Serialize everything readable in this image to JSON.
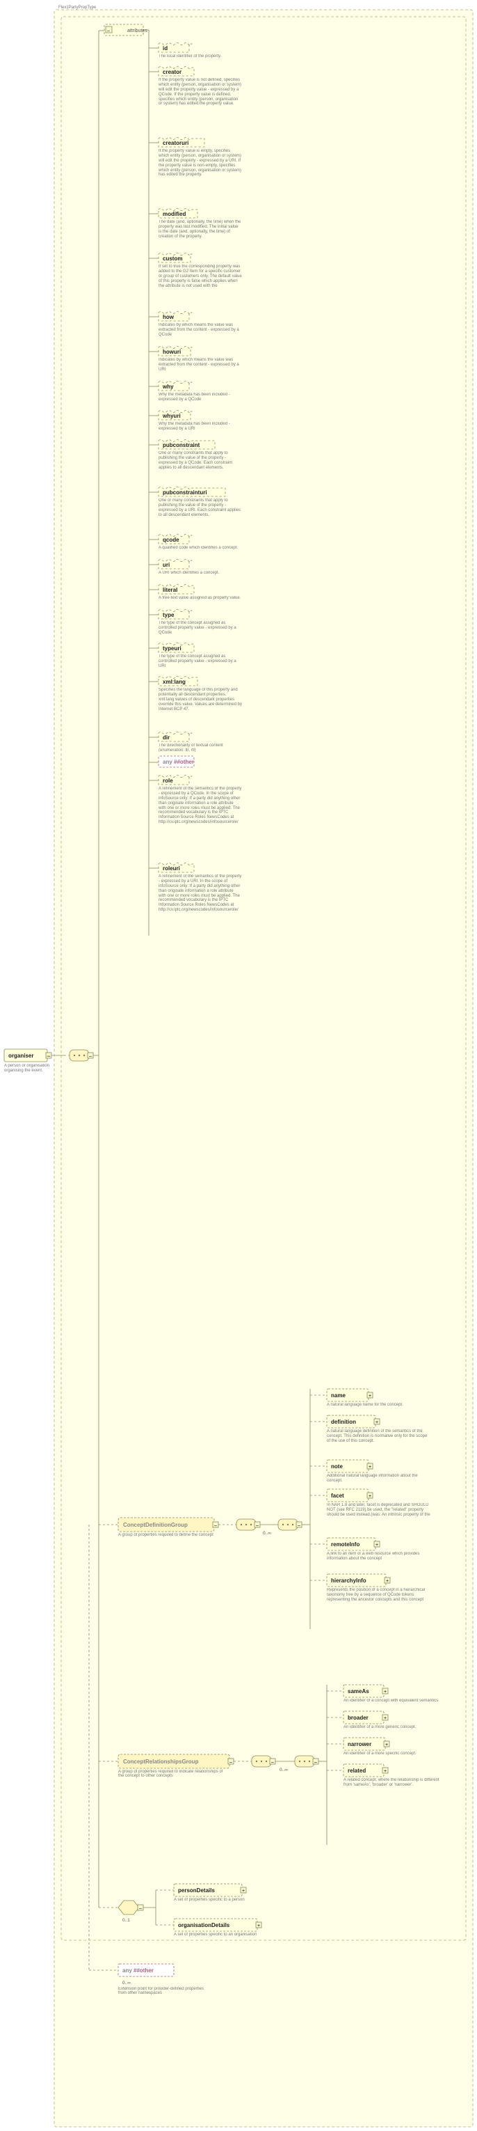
{
  "header": {
    "title": "Flex1PartyPropType"
  },
  "root": {
    "name": "organiser",
    "desc": "A person or organisation organising the event."
  },
  "attributes_label": "attributes",
  "attrs": [
    {
      "key": "id",
      "name": "id",
      "desc": "The local identifier of the property."
    },
    {
      "key": "creator",
      "name": "creator",
      "desc": "If the property value is not defined, specifies which entity (person, organisation or system) will edit the property value - expressed by a QCode. If the property value is defined, specifies which entity (person, organisation or system) has edited the property  value."
    },
    {
      "key": "creatoruri",
      "name": "creatoruri",
      "desc": "If the property value is empty, specifies which entity (person, organisation or system) will edit the property - expressed by a URI. If the property value is non-empty, specifies which entity (person, organisation or system) has edited the property."
    },
    {
      "key": "modified",
      "name": "modified",
      "desc": "The date (and, optionally, the time) when the property was last modified. The initial value is the date (and, optionally, the time) of creation of the property."
    },
    {
      "key": "custom",
      "name": "custom",
      "desc": "If set to true the corresponding property was added to the G2 Item for a specific customer or group of customers only. The default value of this property is false which applies when the attribute is not used with the"
    },
    {
      "key": "how",
      "name": "how",
      "desc": "Indicates by which means the value was extracted from the content -  expressed by a QCode"
    },
    {
      "key": "howuri",
      "name": "howuri",
      "desc": "Indicates by which means the value was extracted from the content - expressed by a URI"
    },
    {
      "key": "why",
      "name": "why",
      "desc": "Why the metadata has been included - expressed by a QCode"
    },
    {
      "key": "whyuri",
      "name": "whyuri",
      "desc": "Why the metadata has been included - expressed by a URI"
    },
    {
      "key": "pubconstraint",
      "name": "pubconstraint",
      "desc": "One or many constraints that apply to publishing the value of the property - expressed by a QCode. Each constraint applies to all descendant elements."
    },
    {
      "key": "pubconstrainturi",
      "name": "pubconstrainturi",
      "desc": "One or many constraints that apply to publishing the value of the property - expressed by a URI. Each constraint applies to all descendant elements."
    },
    {
      "key": "qcode",
      "name": "qcode",
      "desc": "A qualified code which identifies a concept."
    },
    {
      "key": "uri",
      "name": "uri",
      "desc": "A URI which identifies a concept."
    },
    {
      "key": "literal",
      "name": "literal",
      "desc": "A free-text value assigned as property value."
    },
    {
      "key": "type",
      "name": "type",
      "desc": "The type of the concept assigned as controlled property value - expressed by a QCode"
    },
    {
      "key": "typeuri",
      "name": "typeuri",
      "desc": "The type of the concept assigned as controlled property value - expressed by a URI"
    },
    {
      "key": "xmllang",
      "name": "xml:lang",
      "desc": "Specifies the language of this property and potentially all descendant properties. xml:lang values of descendant properties override this value. Values are determined by Internet BCP 47."
    },
    {
      "key": "dir",
      "name": "dir",
      "desc": "The directionality of textual content (enumeration: ltr, rtl)"
    },
    {
      "key": "anyother",
      "name": "##other",
      "desc": "",
      "any": true
    },
    {
      "key": "role",
      "name": "role",
      "desc": "A refinement of the semantics of the property - expressed by a QCode. In the scope of infoSource only: If a party did anything other than originate information a role attribute with one or more roles must be applied. The recommended vocabulary is the IPTC Information Source Roles NewsCodes at http://cv.iptc.org/newscodes/infosourcerole/"
    },
    {
      "key": "roleuri",
      "name": "roleuri",
      "desc": "A refinement of the semantics of the property - expressed by a URI. In the scope of infoSource only: If a party did anything other than originate information a role attribute with one or more roles must be applied. The recommended vocabulary is the IPTC Information Source Roles NewsCodes at http://cv.iptc.org/newscodes/infosourcerole/"
    }
  ],
  "groups": {
    "def": {
      "name": "ConceptDefinitionGroup",
      "desc": "A group of properties required to define the concept"
    },
    "rel": {
      "name": "ConceptRelationshipsGroup",
      "desc": "A group of properties required to indicate relationships of the concept to other concepts"
    }
  },
  "defChildren": [
    {
      "key": "name",
      "name": "name",
      "desc": "A natural language name for the concept."
    },
    {
      "key": "definition",
      "name": "definition",
      "desc": "A natural language definition of the semantics of the concept. This definition is normative only for the scope of the use of this concept."
    },
    {
      "key": "note",
      "name": "note",
      "desc": "Additional natural language information about the concept."
    },
    {
      "key": "facet",
      "name": "facet",
      "desc": "In NAR 1.8 and later, facet is deprecated and SHOULD NOT (see RFC 2119)  be used, the \"related\" property should be used instead.(was: An intrinsic property of the"
    },
    {
      "key": "remoteInfo",
      "name": "remoteInfo",
      "desc": "A link to an item or a web resource which provides information about the concept"
    },
    {
      "key": "hierarchyInfo",
      "name": "hierarchyInfo",
      "desc": "Represents the position of a concept in a hierarchical taxonomy tree by a sequence of QCode tokens representing the ancestor concepts and this concept"
    }
  ],
  "relChildren": [
    {
      "key": "sameAs",
      "name": "sameAs",
      "desc": "An identifier of a concept with equivalent semantics"
    },
    {
      "key": "broader",
      "name": "broader",
      "desc": "An identifier of a more generic concept."
    },
    {
      "key": "narrower",
      "name": "narrower",
      "desc": "An identifier of a more specific concept."
    },
    {
      "key": "related",
      "name": "related",
      "desc": "A related concept, where the relationship is different from 'sameAs', 'broader' or 'narrower'."
    }
  ],
  "choice": {
    "person": {
      "name": "personDetails",
      "desc": "A set of properties specific to a person"
    },
    "org": {
      "name": "organisationDetails",
      "desc": "A set of properties specific to an organisation"
    }
  },
  "ext": {
    "name": "##other",
    "desc": "Extension point for provider-defined properties from other namespaces"
  },
  "occurrence": {
    "zero_inf": "0..∞",
    "zero_one": "0..1"
  },
  "glyphs": {
    "plus": "+",
    "minus": "–",
    "any_prefix": "any "
  }
}
